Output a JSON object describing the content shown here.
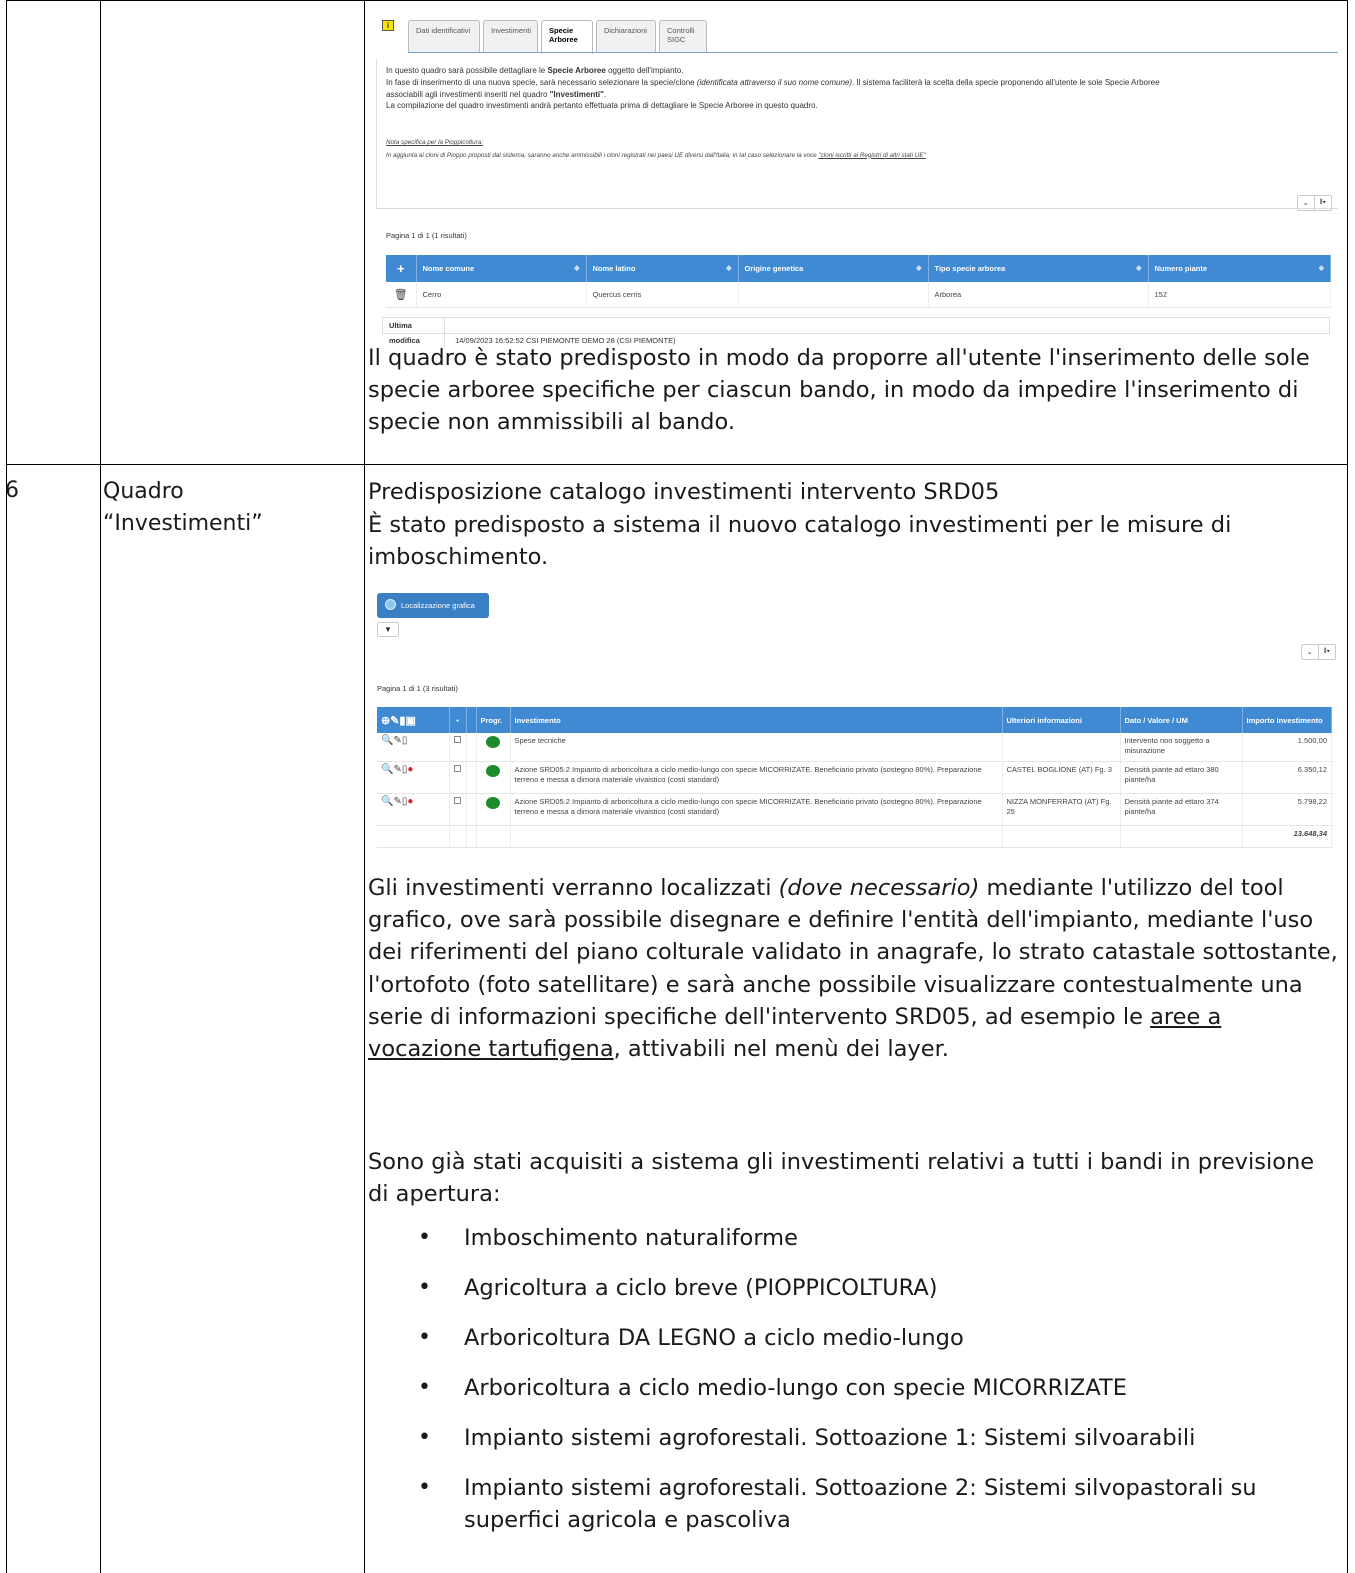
{
  "row5": {
    "screenshot": {
      "tabs": [
        {
          "label": "Dati identificativi",
          "active": false
        },
        {
          "label": "Investimenti",
          "active": false
        },
        {
          "label": "Specie Arboree",
          "active": true
        },
        {
          "label": "Dichiarazioni",
          "active": false
        },
        {
          "label": "Controlli SIGC",
          "active": false
        }
      ],
      "intro": {
        "line1_pre": "In questo quadro sarà possibile dettagliare le ",
        "line1_bold": "Specie Arboree",
        "line1_post": " oggetto dell'impianto.",
        "line2_pre": "In fase di inserimento di una nuova specie, sarà necessario selezionare la specie/clone ",
        "line2_italic": "(identificata attraverso il suo nome comune)",
        "line2_post": ". Il sistema faciliterà la scelta della specie proponendo all'utente le sole Specie Arboree",
        "line3_pre": "associabili agli investimenti inseriti nel quadro ",
        "line3_bold": "\"Investimenti\"",
        "line3_post": ".",
        "line4": "La compilazione del quadro investimenti andrà pertanto effettuata prima di dettagliare le Specie Arboree in questo quadro.",
        "note_title": "Nota specifica per la Pioppicoltura:",
        "note_pre": "In aggiunta ai cloni di Pioppo proposti dal sistema, saranno anche ammissibili i cloni registrati nei paesi UE diversi dall'Italia; in tal caso selezionare la voce ",
        "note_link": "\"cloni iscritti ai Registri di altri stati UE\""
      },
      "pagination": "Pagina 1 di 1 (1 risultati)",
      "columns": [
        "Nome comune",
        "Nome latino",
        "Origine genetica",
        "Tipo specie arborea",
        "Numero piante"
      ],
      "rows": [
        {
          "nome_comune": "Cerro",
          "nome_latino": "Quercus cerris",
          "origine": "",
          "tipo": "Arborea",
          "numero": "152"
        }
      ],
      "last_modified_label": "Ultima modifica",
      "last_modified_value": "14/09/2023 16:52:52 CSI PIEMONTE DEMO 28 (CSI PIEMONTE)"
    },
    "text": "Il quadro è stato predisposto in modo da proporre all'utente l'inserimento delle sole specie arboree specifiche per ciascun bando, in modo da impedire l'inserimento di specie non ammissibili al bando."
  },
  "row6": {
    "number": "6",
    "name_line1": "Quadro",
    "name_line2": "“Investimenti”",
    "heading": "Predisposizione catalogo investimenti intervento SRD05",
    "intro": "È stato predisposto a sistema il nuovo catalogo investimenti per le misure di imboschimento.",
    "screenshot": {
      "loc_button": "Localizzazione grafica",
      "filter_icon": "▼",
      "pagination": "Pagina 1 di 1 (3 risultati)",
      "columns": [
        "Progr.",
        "Investimento",
        "Ulteriori informazioni",
        "Dato / Valore / UM",
        "Importo Investimento"
      ],
      "rows": [
        {
          "investimento": "Spese tecniche",
          "info": "",
          "dato": "Intervento non soggetto a misurazione",
          "importo": "1.500,00",
          "pin": false
        },
        {
          "investimento": "Azione SRD05.2 Impianto di arboricoltura a ciclo medio-lungo con specie MICORRIZATE. Beneficiario privato (sostegno 80%). Preparazione terreno e messa a dimora materiale vivaistico (costi standard)",
          "info": "CASTEL BOGLIONE (AT) Fg. 3",
          "dato": "Densità piante ad ettaro 380 piante/ha",
          "importo": "6.350,12",
          "pin": true
        },
        {
          "investimento": "Azione SRD05.2 Impianto di arboricoltura a ciclo medio-lungo con specie MICORRIZATE. Beneficiario privato (sostegno 80%). Preparazione terreno e messa a dimora materiale vivaistico (costi standard)",
          "info": "NIZZA MONFERRATO (AT) Fg. 25",
          "dato": "Densità piante ad ettaro 374 piante/ha",
          "importo": "5.798,22",
          "pin": true
        }
      ],
      "total": "13.648,34"
    },
    "para1_a": "Gli investimenti verranno localizzati ",
    "para1_italic": "(dove necessario)",
    "para1_b": " mediante l'utilizzo del tool grafico, ove sarà possibile disegnare e definire l'entità dell'impianto, mediante l'uso dei riferimenti del piano colturale validato in anagrafe, lo strato catastale sottostante, l'ortofoto (foto satellitare) e sarà anche possibile visualizzare contestualmente una serie di informazioni specifiche dell'intervento SRD05, ad esempio le ",
    "para1_link": "aree a vocazione tartufigena",
    "para1_c": ", attivabili nel menù dei layer.",
    "para2": "Sono già stati acquisiti a sistema gli investimenti relativi a tutti i bandi in previsione di apertura:",
    "bullets": [
      "Imboschimento naturaliforme",
      "Agricoltura a ciclo breve (PIOPPICOLTURA)",
      "Arboricoltura DA LEGNO a ciclo medio-lungo",
      "Arboricoltura a ciclo medio-lungo con specie MICORRIZATE",
      "Impianto sistemi agroforestali. Sottoazione 1:  Sistemi silvoarabili",
      "Impianto sistemi agroforestali. Sottoazione 2:  Sistemi silvopastorali su superfici agricola e pascoliva"
    ]
  }
}
